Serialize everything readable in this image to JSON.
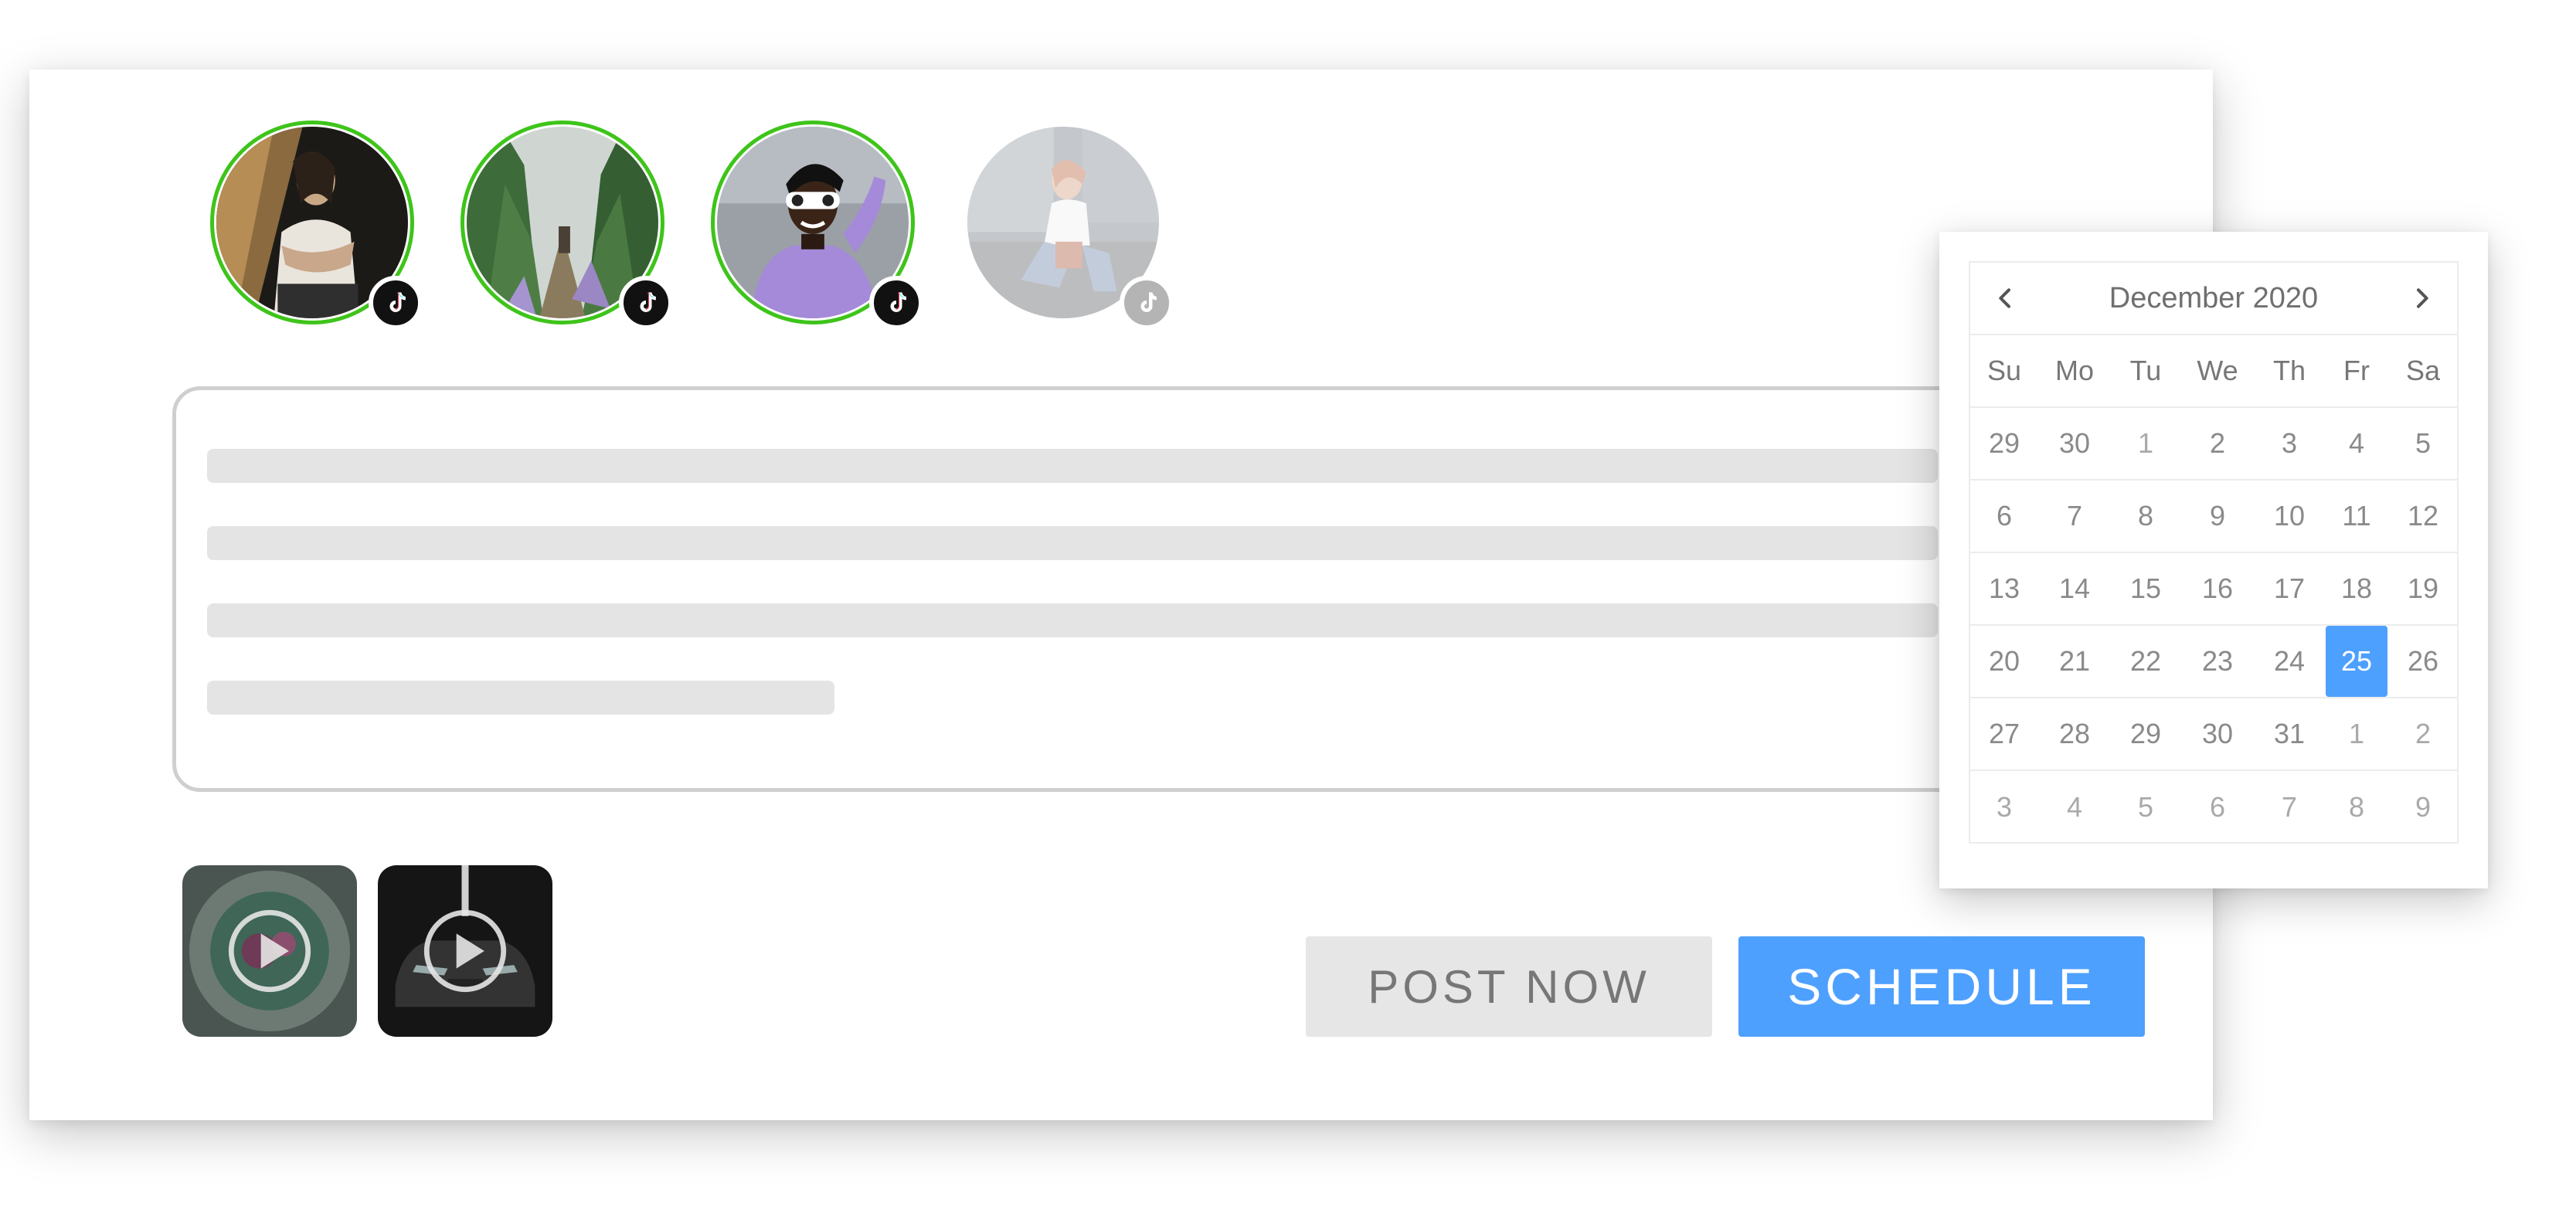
{
  "accounts": [
    {
      "name": "account-1",
      "selected": true,
      "platform_icon": "tiktok-icon"
    },
    {
      "name": "account-2",
      "selected": true,
      "platform_icon": "tiktok-icon"
    },
    {
      "name": "account-3",
      "selected": true,
      "platform_icon": "tiktok-icon"
    },
    {
      "name": "account-4",
      "selected": false,
      "platform_icon": "tiktok-icon"
    }
  ],
  "media": [
    {
      "type": "video",
      "icon": "play-icon"
    },
    {
      "type": "video",
      "icon": "play-icon"
    }
  ],
  "actions": {
    "post_now_label": "POST NOW",
    "schedule_label": "SCHEDULE"
  },
  "calendar": {
    "month_label": "December 2020",
    "prev_icon": "chevron-left-icon",
    "next_icon": "chevron-right-icon",
    "weekdays": [
      "Su",
      "Mo",
      "Tu",
      "We",
      "Th",
      "Fr",
      "Sa"
    ],
    "weeks": [
      [
        "29",
        "30",
        "1",
        "2",
        "3",
        "4",
        "5"
      ],
      [
        "6",
        "7",
        "8",
        "9",
        "10",
        "11",
        "12"
      ],
      [
        "13",
        "14",
        "15",
        "16",
        "17",
        "18",
        "19"
      ],
      [
        "20",
        "21",
        "22",
        "23",
        "24",
        "25",
        "26"
      ],
      [
        "27",
        "28",
        "29",
        "30",
        "31",
        "1",
        "2"
      ],
      [
        "3",
        "4",
        "5",
        "6",
        "7",
        "8",
        "9"
      ]
    ],
    "selected_day": "25"
  },
  "colors": {
    "accent": "#4ea0ff",
    "selected_ring": "#3ec41a",
    "skeleton": "#e4e4e4"
  }
}
